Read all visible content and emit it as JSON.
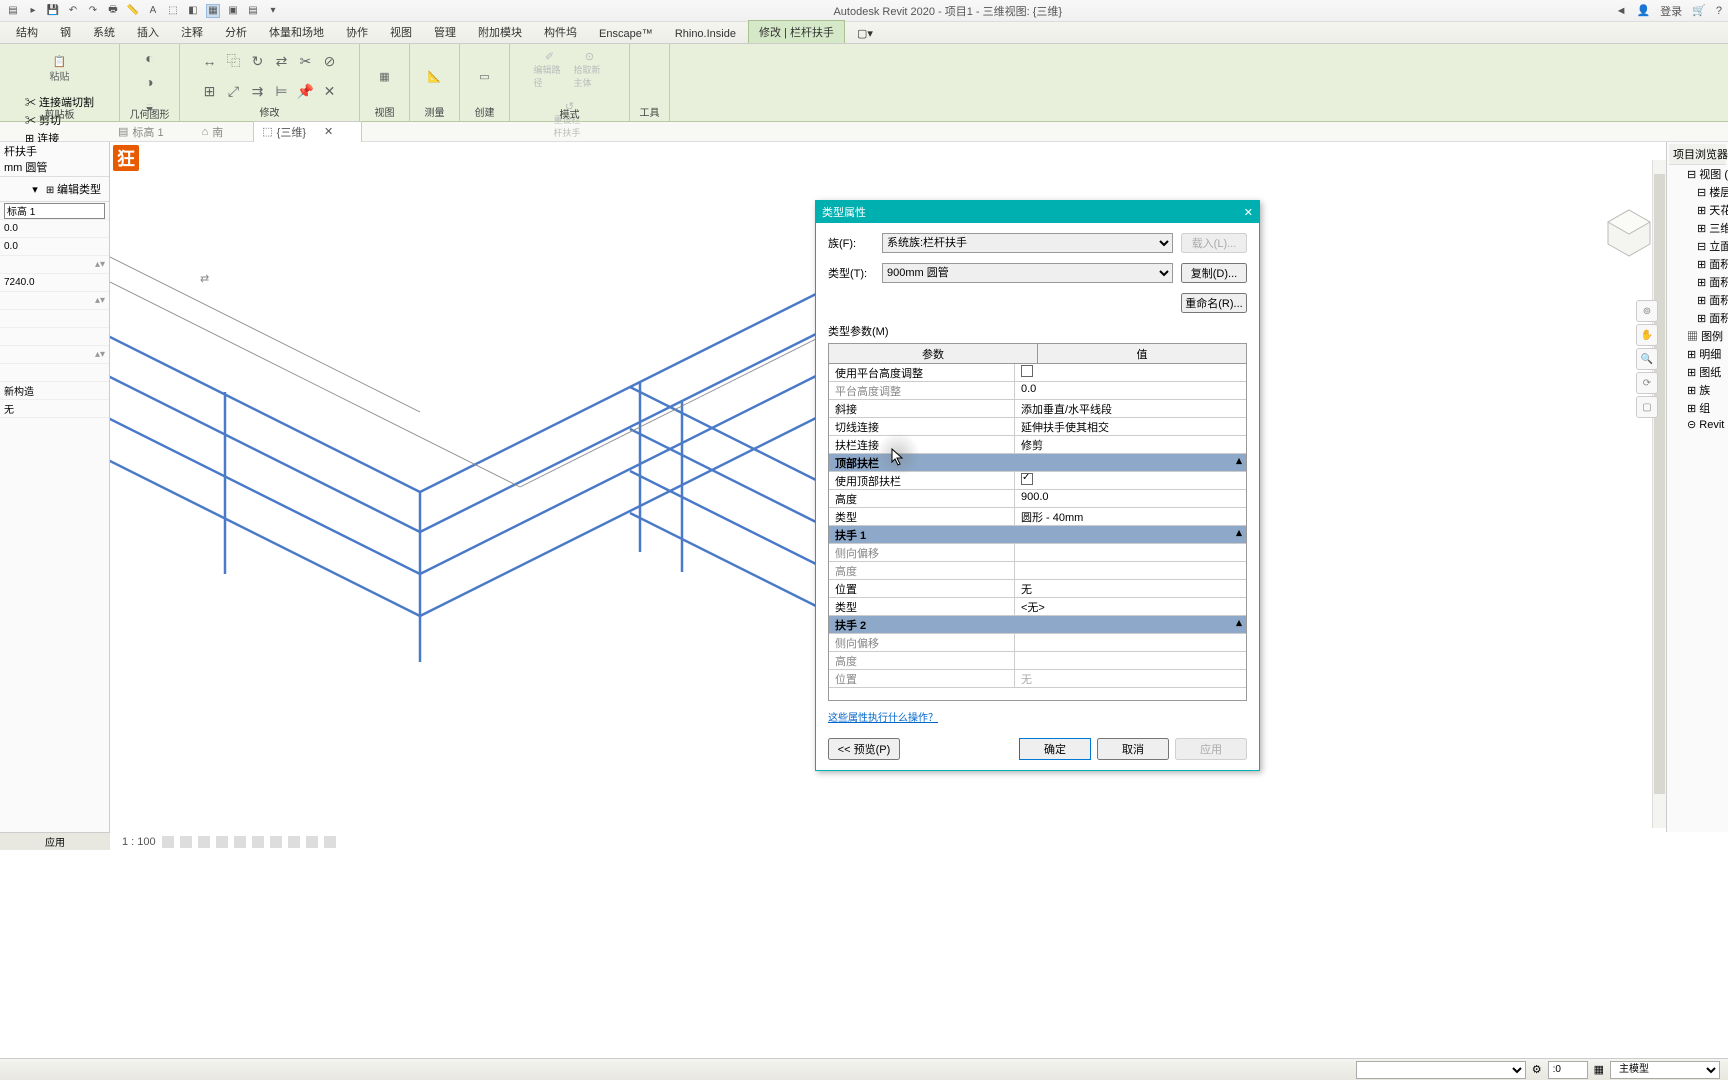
{
  "app": {
    "title": "Autodesk Revit 2020 - 项目1 - 三维视图: {三维}",
    "login": "登录"
  },
  "tabs": [
    "结构",
    "钢",
    "系统",
    "插入",
    "注释",
    "分析",
    "体量和场地",
    "协作",
    "视图",
    "管理",
    "附加模块",
    "构件坞",
    "Enscape™",
    "Rhino.Inside",
    "修改 | 栏杆扶手"
  ],
  "panels": {
    "clipboard": {
      "paste": "粘贴",
      "label": "剪贴板",
      "join_cut": "连接端切割",
      "cut": "剪切",
      "join": "连接"
    },
    "geometry": "几何图形",
    "modify": "修改",
    "view": "视图",
    "measure": "测量",
    "create": "创建",
    "mode": {
      "label": "模式",
      "edit": "编辑路径",
      "pick": "拾取新主体",
      "reset": "重设栏杆扶手"
    },
    "tools": "工具"
  },
  "doc_tabs": {
    "t1": "标高 1",
    "t2": "南",
    "t3": "{三维}"
  },
  "prop": {
    "name1": "杆扶手",
    "name2": "mm 圆管",
    "edit_type": "编辑类型",
    "level_label": "标高 1",
    "off1": "0.0",
    "off2": "0.0",
    "length": "7240.0",
    "phase": "新构造",
    "none": "无",
    "apply": "应用"
  },
  "status": {
    "scale": "1 : 100",
    "zero": ":0",
    "model": "主模型"
  },
  "browser": {
    "title": "项目浏览器 -",
    "views": "视图 (",
    "floor": "楼层",
    "ceil": "天花",
    "threed": "三维",
    "elev": "立面",
    "area1": "面积",
    "area2": "面积",
    "area3": "面积",
    "area4": "面积",
    "legend": "图例",
    "sched": "明细",
    "sheet": "图纸",
    "fam": "族",
    "group": "组",
    "link": "Revit"
  },
  "dlg": {
    "title": "类型属性",
    "close": "✕",
    "family_label": "族(F):",
    "family_value": "系统族:栏杆扶手",
    "load": "载入(L)...",
    "type_label": "类型(T):",
    "type_value": "900mm 圆管",
    "duplicate": "复制(D)...",
    "rename": "重命名(R)...",
    "type_params": "类型参数(M)",
    "col_param": "参数",
    "col_value": "值",
    "rows": {
      "use_landing": "使用平台高度调整",
      "landing_h": "平台高度调整",
      "landing_h_v": "0.0",
      "angled": "斜接",
      "angled_v": "添加垂直/水平线段",
      "tangent": "切线连接",
      "tangent_v": "延伸扶手使其相交",
      "rail_conn": "扶栏连接",
      "rail_conn_v": "修剪",
      "top_rail": "顶部扶栏",
      "use_top": "使用顶部扶栏",
      "height": "高度",
      "height_v": "900.0",
      "type": "类型",
      "type_v": "圆形 - 40mm",
      "hand1": "扶手 1",
      "lateral": "侧向偏移",
      "h2": "高度",
      "pos": "位置",
      "pos_v": "无",
      "type2": "类型",
      "type2_v": "<无>",
      "hand2": "扶手 2",
      "lateral2": "侧向偏移",
      "h3": "高度",
      "pos2": "位置",
      "pos2_v": "无"
    },
    "help": "这些属性执行什么操作？",
    "preview": "<< 预览(P)",
    "ok": "确定",
    "cancel": "取消",
    "apply": "应用"
  }
}
